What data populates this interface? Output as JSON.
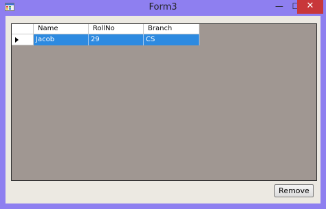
{
  "window": {
    "title": "Form3",
    "controls": {
      "minimize": "—",
      "maximize": "☐",
      "close": "✕"
    }
  },
  "grid": {
    "columns": [
      "Name",
      "RollNo",
      "Branch"
    ],
    "rows": [
      {
        "Name": "Jacob",
        "RollNo": "29",
        "Branch": "CS",
        "selected": true
      }
    ]
  },
  "buttons": {
    "remove": "Remove"
  }
}
